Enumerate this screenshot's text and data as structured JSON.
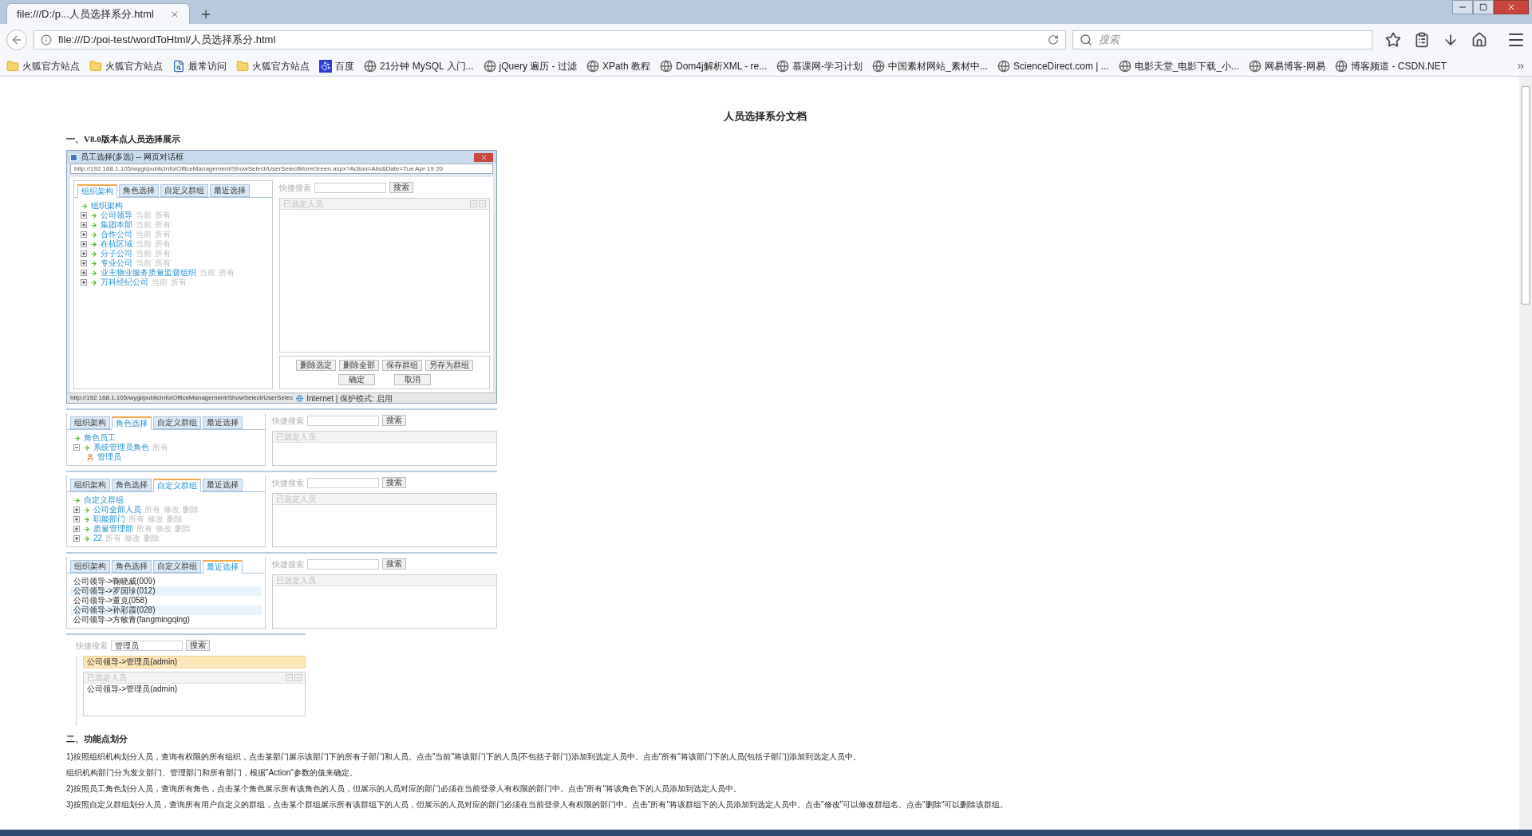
{
  "browser": {
    "tabs": [
      {
        "label": "file:///D:/p...人员选择系分.html",
        "selected": true
      }
    ],
    "url": "file:///D:/poi-test/wordToHtml/人员选择系分.html",
    "search_placeholder": "搜索",
    "bookmarks": [
      {
        "label": "火狐官方站点",
        "kind": "folder"
      },
      {
        "label": "火狐官方站点",
        "kind": "folder"
      },
      {
        "label": "最常访问",
        "kind": "page"
      },
      {
        "label": "火狐官方站点",
        "kind": "folder"
      },
      {
        "label": "百度",
        "kind": "paw"
      },
      {
        "label": "21分钟 MySQL 入门...",
        "kind": "globe"
      },
      {
        "label": "jQuery 遍历 - 过滤",
        "kind": "globe"
      },
      {
        "label": "XPath 教程",
        "kind": "globe"
      },
      {
        "label": "Dom4j解析XML - re...",
        "kind": "globe"
      },
      {
        "label": "慕课网-学习计划",
        "kind": "globe"
      },
      {
        "label": "中国素材网站_素材中...",
        "kind": "globe"
      },
      {
        "label": "ScienceDirect.com | ...",
        "kind": "globe"
      },
      {
        "label": "电影天堂_电影下载_小...",
        "kind": "globe"
      },
      {
        "label": "网易博客-网易",
        "kind": "globe"
      },
      {
        "label": "博客频道 - CSDN.NET",
        "kind": "globe"
      }
    ]
  },
  "document": {
    "title": "人员选择系分文档",
    "section_1": "一、V8.0版本点人员选择展示",
    "screens": [
      {
        "kind": "dialog",
        "title": "员工选择(多选) -- 网页对话框",
        "address": "http://192.168.1.105/wygl/publicInfo/OfficeManagement/ShowSelect/UserSelectMoreGreen.aspx?Action=Alls&Date=Tue Apr 19 20",
        "tabs": [
          {
            "label": "组织架构",
            "selected": true
          },
          {
            "label": "角色选择",
            "selected": false
          },
          {
            "label": "自定义群组",
            "selected": false
          },
          {
            "label": "最近选择",
            "selected": false
          }
        ],
        "search": {
          "label": "快捷搜索",
          "button": "搜索"
        },
        "tree": {
          "root": "组织架构",
          "items": [
            {
              "name": "公司领导",
              "expanded": false,
              "actions": [
                "当前",
                "所有"
              ]
            },
            {
              "name": "集团本部",
              "expanded": false,
              "actions": [
                "当前",
                "所有"
              ]
            },
            {
              "name": "合作公司",
              "expanded": false,
              "actions": [
                "当前",
                "所有"
              ]
            },
            {
              "name": "在杭区域",
              "expanded": false,
              "actions": [
                "当前",
                "所有"
              ]
            },
            {
              "name": "分子公司",
              "expanded": false,
              "actions": [
                "当前",
                "所有"
              ]
            },
            {
              "name": "专业公司",
              "expanded": false,
              "actions": [
                "当前",
                "所有"
              ]
            },
            {
              "name": "业主物业服务质量监督组织",
              "expanded": false,
              "actions": [
                "当前",
                "所有"
              ]
            },
            {
              "name": "万科经纪公司",
              "expanded": false,
              "actions": [
                "当前",
                "所有"
              ]
            }
          ]
        },
        "selected_header": "已选定人员",
        "action_buttons": [
          "删除选定",
          "删除全部",
          "保存群组",
          "另存为群组"
        ],
        "confirm_buttons": [
          "确定",
          "取消"
        ],
        "status_url": "http://192.168.1.105/wygl/publicInfo/OfficeManagement/ShowSelect/UserSelec",
        "status_zone": "Internet | 保护模式: 启用"
      },
      {
        "kind": "tree",
        "tabs": [
          {
            "label": "组织架构",
            "selected": false
          },
          {
            "label": "角色选择",
            "selected": true
          },
          {
            "label": "自定义群组",
            "selected": false
          },
          {
            "label": "最近选择",
            "selected": false
          }
        ],
        "search": {
          "label": "快捷搜索",
          "button": "搜索"
        },
        "tree": {
          "root": "角色员工",
          "items": [
            {
              "name": "系统管理员角色",
              "expanded": true,
              "actions": [
                "所有"
              ],
              "children": [
                {
                  "name": "管理员",
                  "kind": "person"
                }
              ]
            }
          ]
        },
        "selected_header": "已选定人员"
      },
      {
        "kind": "tree",
        "tabs": [
          {
            "label": "组织架构",
            "selected": false
          },
          {
            "label": "角色选择",
            "selected": false
          },
          {
            "label": "自定义群组",
            "selected": true
          },
          {
            "label": "最近选择",
            "selected": false
          }
        ],
        "search": {
          "label": "快捷搜索",
          "button": "搜索"
        },
        "tree": {
          "root": "自定义群组",
          "items": [
            {
              "name": "公司全部人员",
              "expanded": false,
              "actions": [
                "所有",
                "修改",
                "删除"
              ]
            },
            {
              "name": "职能部门",
              "expanded": false,
              "actions": [
                "所有",
                "修改",
                "删除"
              ]
            },
            {
              "name": "质量管理部",
              "expanded": false,
              "actions": [
                "所有",
                "修改",
                "删除"
              ]
            },
            {
              "name": "22",
              "expanded": false,
              "actions": [
                "所有",
                "修改",
                "删除"
              ]
            }
          ]
        },
        "selected_header": "已选定人员"
      },
      {
        "kind": "recent",
        "tabs": [
          {
            "label": "组织架构",
            "selected": false
          },
          {
            "label": "角色选择",
            "selected": false
          },
          {
            "label": "自定义群组",
            "selected": false
          },
          {
            "label": "最近选择",
            "selected": true
          }
        ],
        "search": {
          "label": "快捷搜索",
          "button": "搜索"
        },
        "recent": [
          "公司领导->鞠晓威(009)",
          "公司领导->罗国珍(012)",
          "公司领导->董克(058)",
          "公司领导->孙彩霞(028)",
          "公司领导->方敏青(fangmingqing)"
        ],
        "selected_header": "已选定人员"
      },
      {
        "kind": "search",
        "search": {
          "label": "快捷搜索",
          "value": "管理员",
          "button": "搜索"
        },
        "results": [
          {
            "label": "公司领导->管理员(admin)",
            "selected": true
          }
        ],
        "selected_header": "已选定人员",
        "selected_people": [
          "公司领导->管理员(admin)"
        ]
      }
    ],
    "section_2": "二、功能点划分",
    "paragraphs": [
      "1)按照组织机构划分人员，查询有权限的所有组织，点击某部门展示该部门下的所有子部门和人员。点击\"当前\"将该部门下的人员(不包括子部门)添加到选定人员中。点击\"所有\"将该部门下的人员(包括子部门)添加到选定人员中。",
      "组织机构部门分为发文部门、管理部门和所有部门，根据\"Action\"参数的值来确定。",
      "2)按照员工角色划分人员，查询所有角色，点击某个角色展示所有该角色的人员，但展示的人员对应的部门必须在当前登录人有权限的部门中。点击\"所有\"将该角色下的人员添加到选定人员中。",
      "3)按照自定义群组划分人员，查询所有用户自定义的群组，点击某个群组展示所有该群组下的人员，但展示的人员对应的部门必须在当前登录人有权限的部门中。点击\"所有\"将该群组下的人员添加到选定人员中。点击\"修改\"可以修改群组名。点击\"删除\"可以删除该群组。"
    ]
  }
}
